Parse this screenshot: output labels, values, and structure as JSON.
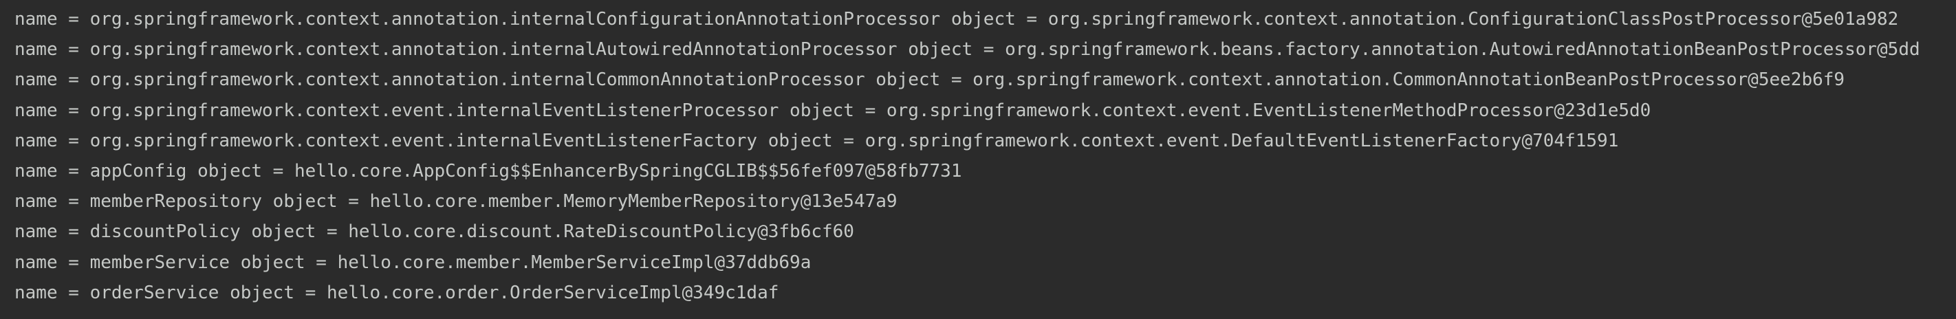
{
  "console": {
    "lines": [
      "name = org.springframework.context.annotation.internalConfigurationAnnotationProcessor object = org.springframework.context.annotation.ConfigurationClassPostProcessor@5e01a982",
      "name = org.springframework.context.annotation.internalAutowiredAnnotationProcessor object = org.springframework.beans.factory.annotation.AutowiredAnnotationBeanPostProcessor@5dd",
      "name = org.springframework.context.annotation.internalCommonAnnotationProcessor object = org.springframework.context.annotation.CommonAnnotationBeanPostProcessor@5ee2b6f9",
      "name = org.springframework.context.event.internalEventListenerProcessor object = org.springframework.context.event.EventListenerMethodProcessor@23d1e5d0",
      "name = org.springframework.context.event.internalEventListenerFactory object = org.springframework.context.event.DefaultEventListenerFactory@704f1591",
      "name = appConfig object = hello.core.AppConfig$$EnhancerBySpringCGLIB$$56fef097@58fb7731",
      "name = memberRepository object = hello.core.member.MemoryMemberRepository@13e547a9",
      "name = discountPolicy object = hello.core.discount.RateDiscountPolicy@3fb6cf60",
      "name = memberService object = hello.core.member.MemberServiceImpl@37ddb69a",
      "name = orderService object = hello.core.order.OrderServiceImpl@349c1daf"
    ]
  }
}
